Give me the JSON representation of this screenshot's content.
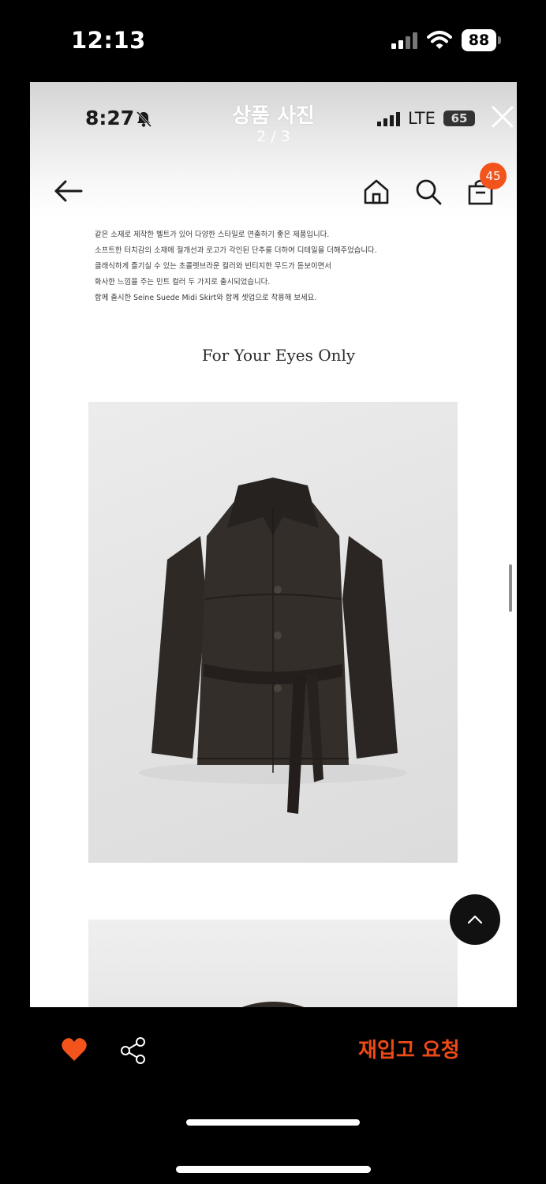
{
  "outer_status": {
    "time": "12:13",
    "battery": "88"
  },
  "inner_status": {
    "time": "8:27",
    "network": "LTE",
    "battery": "65"
  },
  "viewer": {
    "title": "상품 사진",
    "counter": "2 / 3"
  },
  "header": {
    "cart_badge": "45"
  },
  "description": {
    "lines": [
      "같은 소재로 제작한 벨트가 있어 다양한 스타일로 연출하기 좋은 제품입니다.",
      "소프트한 터치감의 소재에 절개선과 로고가 각인된 단추를 더하여 디테일을 더해주었습니다.",
      "클래식하게 즐기실 수 있는 초콜렛브라운 컬러와 빈티지한 무드가 돋보이면서",
      "화사한 느낌을 주는 민트 컬러 두 가지로 출시되었습니다.",
      "함께 출시한 Seine Suede Midi Skirt와 함께 셋업으로 착용해 보세요."
    ]
  },
  "section": {
    "title": "For Your Eyes Only"
  },
  "bottom_bar": {
    "restock_label": "재입고 요청"
  },
  "colors": {
    "accent": "#ee4a16",
    "badge": "#f2541b",
    "jacket": "#2e2925"
  }
}
